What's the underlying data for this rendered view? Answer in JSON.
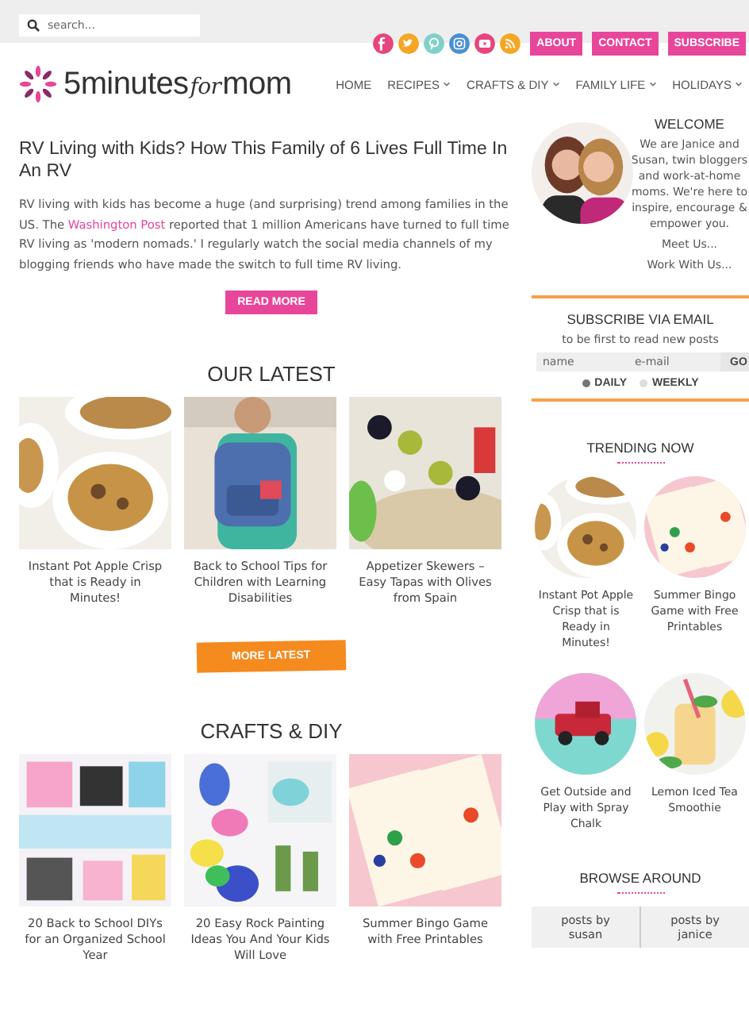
{
  "search": {
    "placeholder": "search..."
  },
  "social": [
    {
      "kind": "facebook",
      "color": "#e8457f"
    },
    {
      "kind": "twitter",
      "color": "#f5a623"
    },
    {
      "kind": "pinterest",
      "color": "#7fd0c8"
    },
    {
      "kind": "instagram",
      "color": "#4a8fd0"
    },
    {
      "kind": "youtube",
      "color": "#e8457f"
    },
    {
      "kind": "rss",
      "color": "#f5a623"
    }
  ],
  "top_links": [
    "ABOUT",
    "CONTACT",
    "SUBSCRIBE"
  ],
  "logo": {
    "lead": "5minutes",
    "script": "for",
    "tail": "mom"
  },
  "nav": [
    {
      "label": "HOME",
      "has_menu": false
    },
    {
      "label": "RECIPES",
      "has_menu": true
    },
    {
      "label": "CRAFTS & DIY",
      "has_menu": true
    },
    {
      "label": "FAMILY LIFE",
      "has_menu": true
    },
    {
      "label": "HOLIDAYS",
      "has_menu": true
    }
  ],
  "article": {
    "title": "RV Living with Kids? How This Family of 6 Lives Full Time In An RV",
    "body": "RV living with kids has become a huge (and surprising) trend among families in the US. The ",
    "link": "Washington Post",
    "body_end": " reported that 1 million Americans have turned to full time RV living as 'modern nomads.' I regularly watch the social media channels of my blogging friends who have made the switch to full time RV living.",
    "button": "READ MORE"
  },
  "sections": [
    {
      "title": "OUR LATEST",
      "posts": [
        "Instant Pot Apple Crisp that is Ready in Minutes!",
        "Back to School Tips for Children with Learning Disabilities",
        "Appetizer Skewers – Easy Tapas with Olives from Spain"
      ],
      "button": "MORE LATEST"
    },
    {
      "title": "CRAFTS & DIY",
      "posts": [
        "20 Back to School DIYs for an Organized School Year",
        "20 Easy Rock Painting Ideas You And Your Kids Will Love",
        "Summer Bingo Game with Free Printables"
      ]
    }
  ],
  "welcome": {
    "title": "WELCOME",
    "text": "We are Janice and Susan, twin bloggers and work-at-home moms. We're here to inspire, encourage & empower you.",
    "links": [
      "Meet Us...",
      "Work With Us..."
    ]
  },
  "subscribe": {
    "title": "SUBSCRIBE VIA EMAIL",
    "subtitle": "to be first to read new posts",
    "name_placeholder": "name",
    "email_placeholder": "e-mail",
    "button": "GO",
    "options": [
      {
        "label": "DAILY",
        "selected": true
      },
      {
        "label": "WEEKLY",
        "selected": false
      }
    ]
  },
  "trending": {
    "title": "TRENDING NOW",
    "posts": [
      "Instant Pot Apple Crisp that is Ready in Minutes!",
      "Summer Bingo Game with Free Printables",
      "Get Outside and Play with Spray Chalk",
      "Lemon Iced Tea Smoothie"
    ]
  },
  "browse": {
    "title": "BROWSE AROUND",
    "links": [
      "posts by susan",
      "posts by janice"
    ]
  }
}
